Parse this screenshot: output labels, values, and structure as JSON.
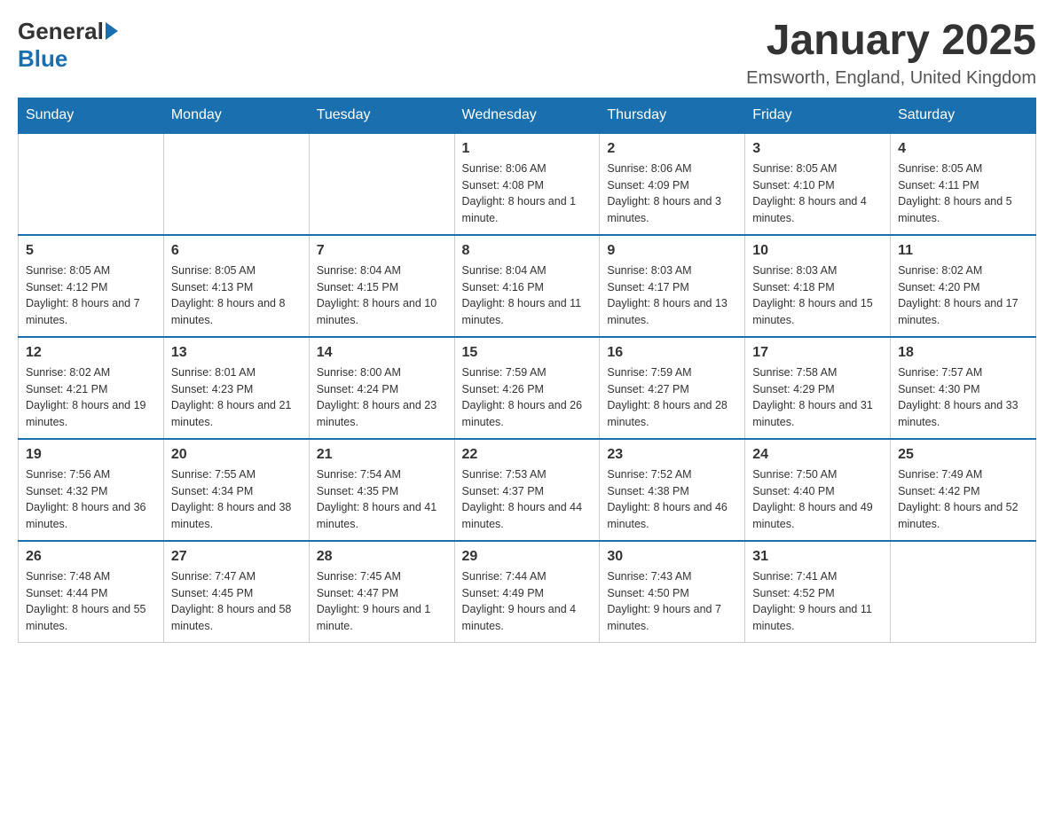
{
  "header": {
    "logo": {
      "general": "General",
      "blue": "Blue"
    },
    "title": "January 2025",
    "subtitle": "Emsworth, England, United Kingdom"
  },
  "days_of_week": [
    "Sunday",
    "Monday",
    "Tuesday",
    "Wednesday",
    "Thursday",
    "Friday",
    "Saturday"
  ],
  "weeks": [
    [
      {
        "day": "",
        "info": ""
      },
      {
        "day": "",
        "info": ""
      },
      {
        "day": "",
        "info": ""
      },
      {
        "day": "1",
        "info": "Sunrise: 8:06 AM\nSunset: 4:08 PM\nDaylight: 8 hours and 1 minute."
      },
      {
        "day": "2",
        "info": "Sunrise: 8:06 AM\nSunset: 4:09 PM\nDaylight: 8 hours and 3 minutes."
      },
      {
        "day": "3",
        "info": "Sunrise: 8:05 AM\nSunset: 4:10 PM\nDaylight: 8 hours and 4 minutes."
      },
      {
        "day": "4",
        "info": "Sunrise: 8:05 AM\nSunset: 4:11 PM\nDaylight: 8 hours and 5 minutes."
      }
    ],
    [
      {
        "day": "5",
        "info": "Sunrise: 8:05 AM\nSunset: 4:12 PM\nDaylight: 8 hours and 7 minutes."
      },
      {
        "day": "6",
        "info": "Sunrise: 8:05 AM\nSunset: 4:13 PM\nDaylight: 8 hours and 8 minutes."
      },
      {
        "day": "7",
        "info": "Sunrise: 8:04 AM\nSunset: 4:15 PM\nDaylight: 8 hours and 10 minutes."
      },
      {
        "day": "8",
        "info": "Sunrise: 8:04 AM\nSunset: 4:16 PM\nDaylight: 8 hours and 11 minutes."
      },
      {
        "day": "9",
        "info": "Sunrise: 8:03 AM\nSunset: 4:17 PM\nDaylight: 8 hours and 13 minutes."
      },
      {
        "day": "10",
        "info": "Sunrise: 8:03 AM\nSunset: 4:18 PM\nDaylight: 8 hours and 15 minutes."
      },
      {
        "day": "11",
        "info": "Sunrise: 8:02 AM\nSunset: 4:20 PM\nDaylight: 8 hours and 17 minutes."
      }
    ],
    [
      {
        "day": "12",
        "info": "Sunrise: 8:02 AM\nSunset: 4:21 PM\nDaylight: 8 hours and 19 minutes."
      },
      {
        "day": "13",
        "info": "Sunrise: 8:01 AM\nSunset: 4:23 PM\nDaylight: 8 hours and 21 minutes."
      },
      {
        "day": "14",
        "info": "Sunrise: 8:00 AM\nSunset: 4:24 PM\nDaylight: 8 hours and 23 minutes."
      },
      {
        "day": "15",
        "info": "Sunrise: 7:59 AM\nSunset: 4:26 PM\nDaylight: 8 hours and 26 minutes."
      },
      {
        "day": "16",
        "info": "Sunrise: 7:59 AM\nSunset: 4:27 PM\nDaylight: 8 hours and 28 minutes."
      },
      {
        "day": "17",
        "info": "Sunrise: 7:58 AM\nSunset: 4:29 PM\nDaylight: 8 hours and 31 minutes."
      },
      {
        "day": "18",
        "info": "Sunrise: 7:57 AM\nSunset: 4:30 PM\nDaylight: 8 hours and 33 minutes."
      }
    ],
    [
      {
        "day": "19",
        "info": "Sunrise: 7:56 AM\nSunset: 4:32 PM\nDaylight: 8 hours and 36 minutes."
      },
      {
        "day": "20",
        "info": "Sunrise: 7:55 AM\nSunset: 4:34 PM\nDaylight: 8 hours and 38 minutes."
      },
      {
        "day": "21",
        "info": "Sunrise: 7:54 AM\nSunset: 4:35 PM\nDaylight: 8 hours and 41 minutes."
      },
      {
        "day": "22",
        "info": "Sunrise: 7:53 AM\nSunset: 4:37 PM\nDaylight: 8 hours and 44 minutes."
      },
      {
        "day": "23",
        "info": "Sunrise: 7:52 AM\nSunset: 4:38 PM\nDaylight: 8 hours and 46 minutes."
      },
      {
        "day": "24",
        "info": "Sunrise: 7:50 AM\nSunset: 4:40 PM\nDaylight: 8 hours and 49 minutes."
      },
      {
        "day": "25",
        "info": "Sunrise: 7:49 AM\nSunset: 4:42 PM\nDaylight: 8 hours and 52 minutes."
      }
    ],
    [
      {
        "day": "26",
        "info": "Sunrise: 7:48 AM\nSunset: 4:44 PM\nDaylight: 8 hours and 55 minutes."
      },
      {
        "day": "27",
        "info": "Sunrise: 7:47 AM\nSunset: 4:45 PM\nDaylight: 8 hours and 58 minutes."
      },
      {
        "day": "28",
        "info": "Sunrise: 7:45 AM\nSunset: 4:47 PM\nDaylight: 9 hours and 1 minute."
      },
      {
        "day": "29",
        "info": "Sunrise: 7:44 AM\nSunset: 4:49 PM\nDaylight: 9 hours and 4 minutes."
      },
      {
        "day": "30",
        "info": "Sunrise: 7:43 AM\nSunset: 4:50 PM\nDaylight: 9 hours and 7 minutes."
      },
      {
        "day": "31",
        "info": "Sunrise: 7:41 AM\nSunset: 4:52 PM\nDaylight: 9 hours and 11 minutes."
      },
      {
        "day": "",
        "info": ""
      }
    ]
  ]
}
